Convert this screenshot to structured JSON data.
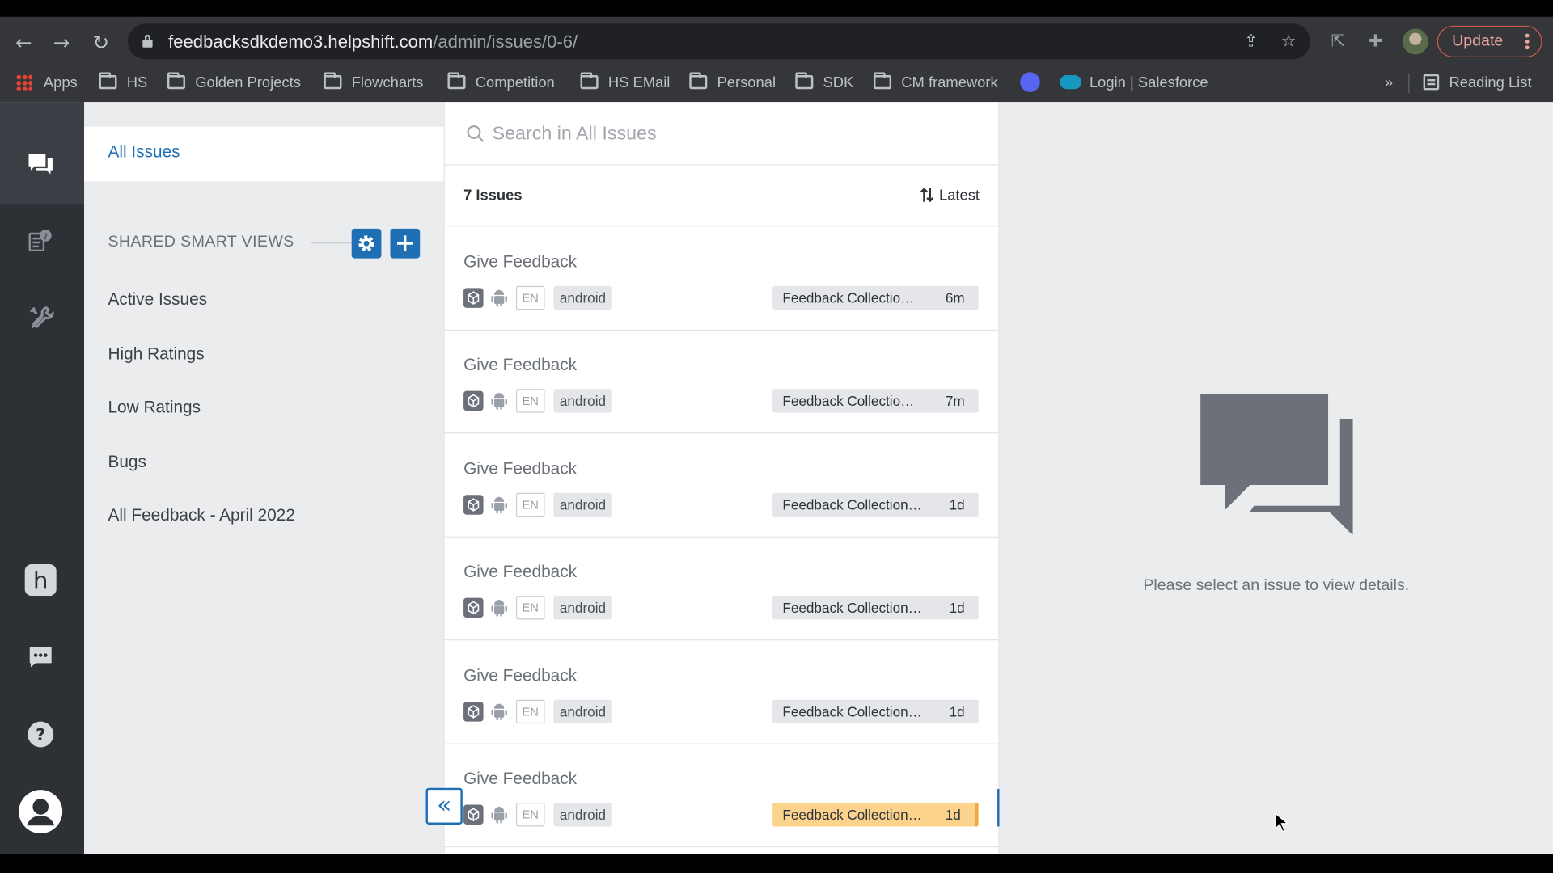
{
  "browser": {
    "url_host": "feedbacksdkdemo3.helpshift.com",
    "url_path": "/admin/issues/0-6/",
    "update_label": "Update",
    "bookmarks": [
      {
        "label": "Apps",
        "icon": "apps-grid-icon"
      },
      {
        "label": "HS",
        "icon": "folder-icon"
      },
      {
        "label": "Golden Projects",
        "icon": "folder-icon"
      },
      {
        "label": "Flowcharts",
        "icon": "folder-icon"
      },
      {
        "label": "Competition",
        "icon": "folder-icon"
      },
      {
        "label": "HS EMail",
        "icon": "folder-icon"
      },
      {
        "label": "Personal",
        "icon": "folder-icon"
      },
      {
        "label": "SDK",
        "icon": "folder-icon"
      },
      {
        "label": "CM framework",
        "icon": "folder-icon"
      },
      {
        "label": "",
        "icon": "discord-icon"
      },
      {
        "label": "Login | Salesforce",
        "icon": "salesforce-icon"
      }
    ],
    "overflow_label": "»",
    "reading_list_label": "Reading List"
  },
  "sidebar": {
    "all_issues": "All Issues",
    "shared_smart_views_label": "SHARED SMART VIEWS",
    "views": [
      "Active Issues",
      "High Ratings",
      "Low Ratings",
      "Bugs",
      "All Feedback - April 2022"
    ]
  },
  "list": {
    "search_placeholder": "Search in All Issues",
    "count_label": "7 Issues",
    "sort_label": "Latest",
    "issues": [
      {
        "title": "Give Feedback",
        "lang": "EN",
        "platform": "android",
        "status": "Feedback Collectio…",
        "time": "6m",
        "highlighted": false
      },
      {
        "title": "Give Feedback",
        "lang": "EN",
        "platform": "android",
        "status": "Feedback Collectio…",
        "time": "7m",
        "highlighted": false
      },
      {
        "title": "Give Feedback",
        "lang": "EN",
        "platform": "android",
        "status": "Feedback Collection…",
        "time": "1d",
        "highlighted": false
      },
      {
        "title": "Give Feedback",
        "lang": "EN",
        "platform": "android",
        "status": "Feedback Collection…",
        "time": "1d",
        "highlighted": false
      },
      {
        "title": "Give Feedback",
        "lang": "EN",
        "platform": "android",
        "status": "Feedback Collection…",
        "time": "1d",
        "highlighted": false
      },
      {
        "title": "Give Feedback",
        "lang": "EN",
        "platform": "android",
        "status": "Feedback Collection…",
        "time": "1d",
        "highlighted": true
      }
    ]
  },
  "detail": {
    "empty_message": "Please select an issue to view details."
  },
  "colors": {
    "accent": "#1f6fb5",
    "highlight": "#fbd38c",
    "nav_bg": "#2d3035"
  }
}
